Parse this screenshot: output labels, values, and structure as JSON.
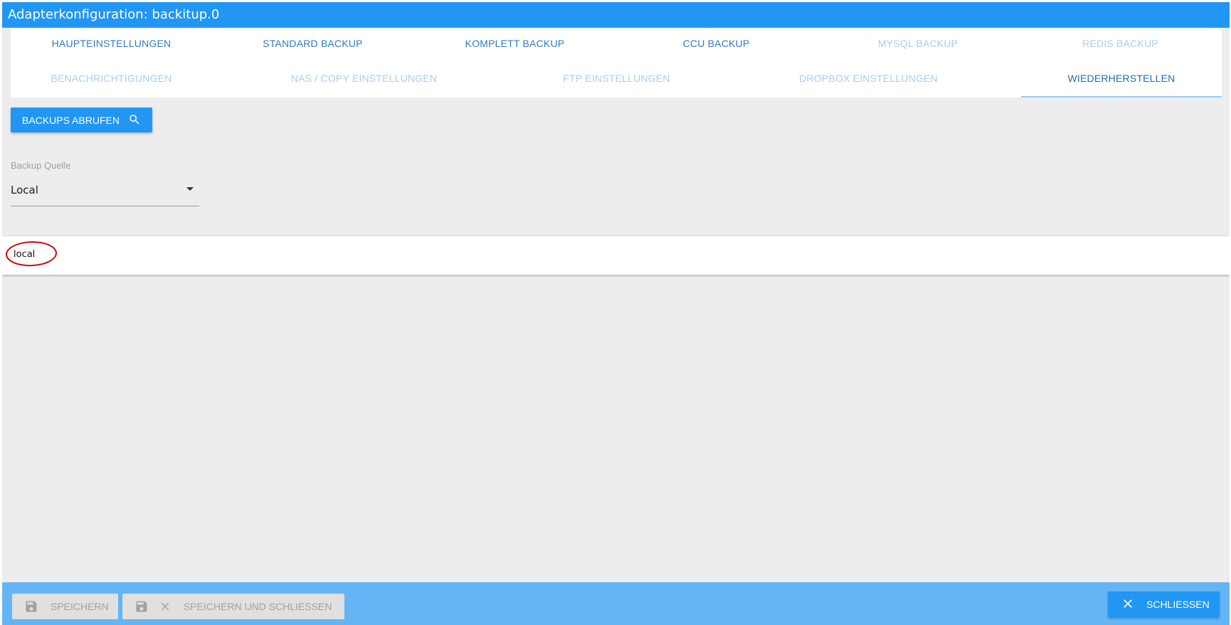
{
  "window": {
    "title": "Adapterkonfiguration: backitup.0"
  },
  "tabs": [
    {
      "label": "HAUPTEINSTELLUNGEN",
      "state": "enabled"
    },
    {
      "label": "STANDARD BACKUP",
      "state": "enabled"
    },
    {
      "label": "KOMPLETT BACKUP",
      "state": "enabled"
    },
    {
      "label": "CCU BACKUP",
      "state": "enabled"
    },
    {
      "label": "MYSQL BACKUP",
      "state": "disabled"
    },
    {
      "label": "REDIS BACKUP",
      "state": "disabled"
    },
    {
      "label": "BENACHRICHTIGUNGEN",
      "state": "disabled"
    },
    {
      "label": "NAS / COPY EINSTELLUNGEN",
      "state": "disabled"
    },
    {
      "label": "FTP EINSTELLUNGEN",
      "state": "disabled"
    },
    {
      "label": "DROPBOX EINSTELLUNGEN",
      "state": "disabled"
    },
    {
      "label": "WIEDERHERSTELLEN",
      "state": "active"
    }
  ],
  "main": {
    "fetch_button": {
      "label": "BACKUPS ABRUFEN",
      "icon": "search-icon"
    },
    "backup_source": {
      "label": "Backup Quelle",
      "value": "Local"
    },
    "list": {
      "items": [
        "local"
      ],
      "highlight": "red-hand-drawn-circle"
    }
  },
  "footer": {
    "save": {
      "label": "SPEICHERN",
      "icon": "save-icon"
    },
    "save_close": {
      "label": "SPEICHERN UND SCHLIESSEN",
      "icons": [
        "save-icon",
        "close-icon"
      ]
    },
    "close": {
      "label": "SCHLIESSEN",
      "icon": "close-icon"
    }
  },
  "colors": {
    "primary": "#2196f3",
    "footer_bg": "#64b5f6",
    "tab_enabled": "#2e7bc4",
    "tab_disabled": "#a9cdee",
    "annotation": "#d10000"
  }
}
